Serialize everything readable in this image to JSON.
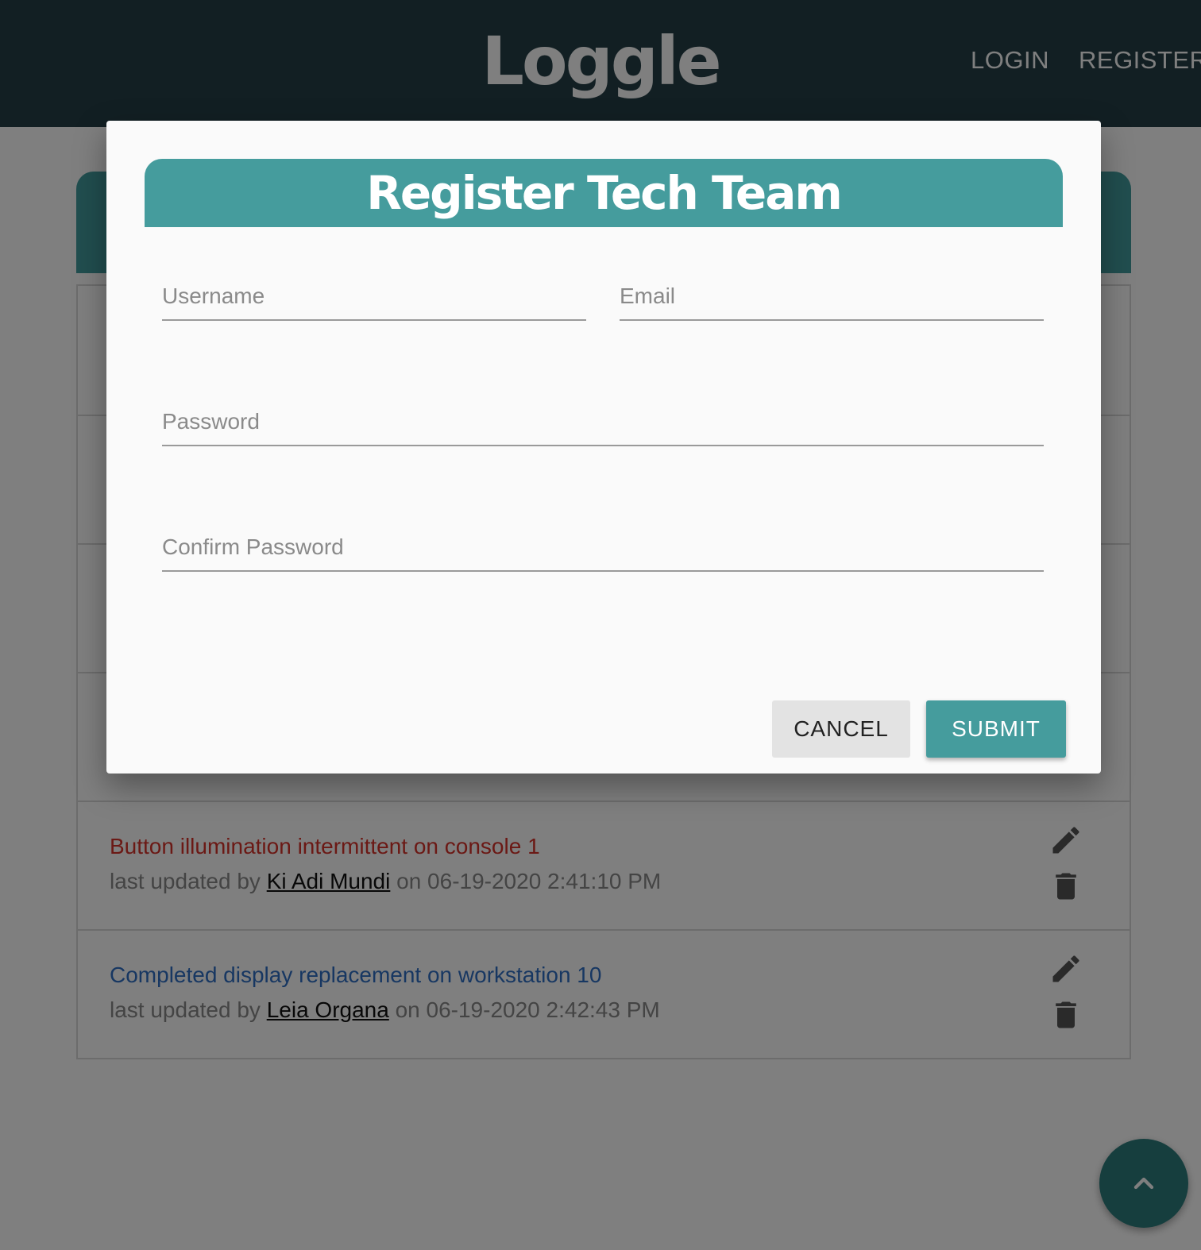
{
  "navbar": {
    "brand": "Loggle",
    "links": [
      "LOGIN",
      "REGISTER"
    ]
  },
  "logs": [
    {
      "title": "Button illumination intermittent on console 1",
      "status_color": "#d7322a",
      "meta_prefix": "last updated by",
      "author": "Ki Adi Mundi",
      "meta_suffix": "on 06-19-2020 2:41:10 PM"
    },
    {
      "title": "Completed display replacement on workstation 10",
      "status_color": "#2f6fc4",
      "meta_prefix": "last updated by",
      "author": "Leia Organa",
      "meta_suffix": "on 06-19-2020 2:42:43 PM"
    }
  ],
  "modal": {
    "title": "Register Tech Team",
    "fields": {
      "username": {
        "placeholder": "Username",
        "value": ""
      },
      "email": {
        "placeholder": "Email",
        "value": ""
      },
      "password": {
        "placeholder": "Password",
        "value": ""
      },
      "confirm_password": {
        "placeholder": "Confirm Password",
        "value": ""
      }
    },
    "cancel_label": "CANCEL",
    "submit_label": "SUBMIT"
  },
  "icons": {
    "edit": "pencil-icon",
    "delete": "trash-icon",
    "scroll_top": "chevron-up-icon"
  },
  "colors": {
    "navbar": "#243f46",
    "accent": "#459c9d",
    "fab": "#2c7c7d"
  }
}
